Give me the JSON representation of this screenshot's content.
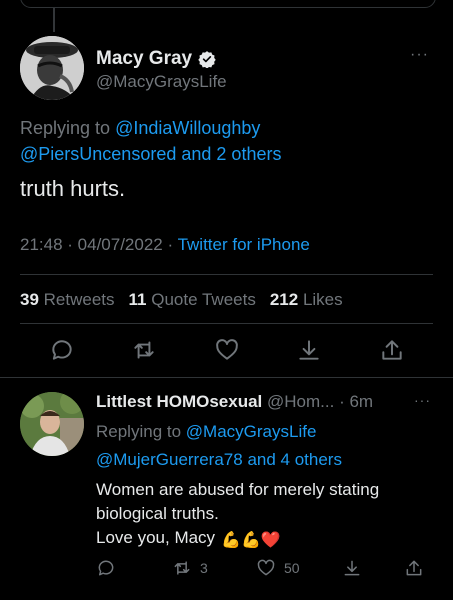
{
  "main_tweet": {
    "display_name": "Macy Gray",
    "handle": "@MacyGraysLife",
    "replying_prefix": "Replying to",
    "replying_to_1": "@IndiaWilloughby",
    "replying_to_2": "@PiersUncensored",
    "replying_and": "and",
    "replying_others": "2 others",
    "text": "truth hurts.",
    "time": "21:48",
    "date": "04/07/2022",
    "source": "Twitter for iPhone",
    "retweets_count": "39",
    "retweets_label": "Retweets",
    "quotes_count": "11",
    "quotes_label": "Quote Tweets",
    "likes_count": "212",
    "likes_label": "Likes",
    "more": "···"
  },
  "reply_tweet": {
    "display_name": "Littlest HOMOsexual",
    "handle": "@Hom...",
    "age": "6m",
    "replying_prefix": "Replying to",
    "replying_to_1": "@MacyGraysLife",
    "replying_to_2": "@MujerGuerrera78",
    "replying_and": "and",
    "replying_others": "4 others",
    "text_line1": "Women are abused for merely stating",
    "text_line2": "biological truths.",
    "text_line3": "Love you, Macy",
    "emojis": "💪💪❤️",
    "retweet_count": "3",
    "like_count": "50",
    "more": "···"
  },
  "colors": {
    "background": "#000000",
    "text": "#e7e9ea",
    "muted": "#71767b",
    "link": "#1d9bf0",
    "divider": "#2f3336"
  }
}
